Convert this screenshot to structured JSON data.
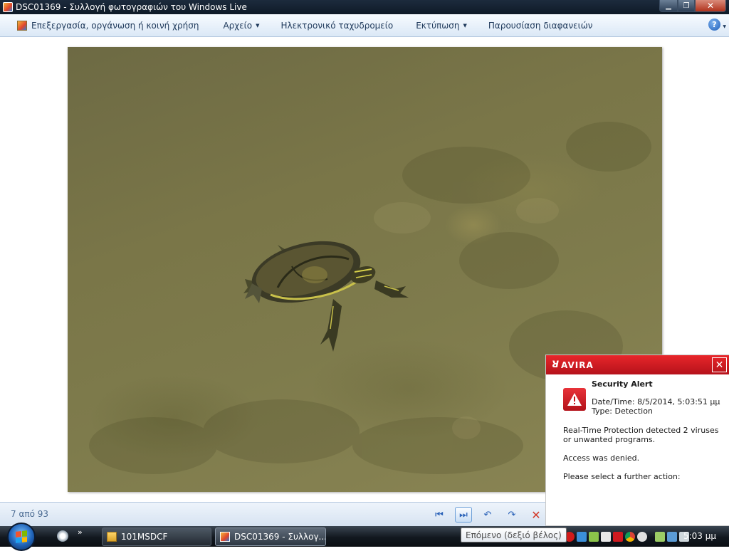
{
  "window": {
    "title": "DSC01369 - Συλλογή φωτογραφιών του Windows Live",
    "min_glyph": "▁",
    "max_glyph": "❐",
    "close_glyph": "✕"
  },
  "commandbar": {
    "edit": "Επεξεργασία, οργάνωση ή κοινή χρήση",
    "file": "Αρχείο",
    "email": "Ηλεκτρονικό ταχυδρομείο",
    "print": "Εκτύπωση",
    "slideshow": "Παρουσίαση διαφανειών",
    "dropdown_arrow": "▼",
    "help_glyph": "?"
  },
  "statusbar": {
    "counter": "7 από 93",
    "prev_glyph": "⏮",
    "next_glyph": "⏭",
    "rotate_left_glyph": "↶",
    "rotate_right_glyph": "↷",
    "delete_glyph": "✕"
  },
  "tooltip": "Επόμενο (δεξιό βέλος)",
  "avira": {
    "brand": "AVIRA",
    "close_glyph": "✕",
    "title": "Security Alert",
    "datetime": "Date/Time: 8/5/2014, 5:03:51 μμ",
    "type": "Type: Detection",
    "message1": "Real-Time Protection detected 2 viruses or unwanted programs.",
    "message2": "Access was denied.",
    "message3": "Please select a further action:"
  },
  "taskbar": {
    "more_glyph": "»",
    "folder_button": "101MSDCF",
    "gallery_button": "DSC01369 - Συλλογ...",
    "clock": "5:03 μμ"
  },
  "colors": {
    "avira_red": "#d0191f",
    "accent_blue": "#2a62b8",
    "taskbar": "#12181f"
  }
}
